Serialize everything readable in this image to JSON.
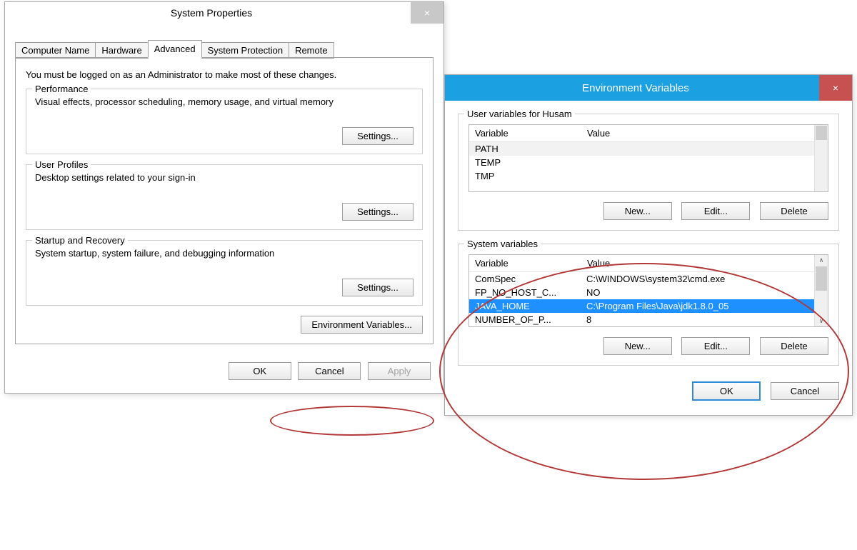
{
  "sysprops": {
    "title": "System Properties",
    "close": "×",
    "tabs": [
      "Computer Name",
      "Hardware",
      "Advanced",
      "System Protection",
      "Remote"
    ],
    "active_tab": 2,
    "admin_note": "You must be logged on as an Administrator to make most of these changes.",
    "performance": {
      "legend": "Performance",
      "desc": "Visual effects, processor scheduling, memory usage, and virtual memory",
      "btn": "Settings..."
    },
    "profiles": {
      "legend": "User Profiles",
      "desc": "Desktop settings related to your sign-in",
      "btn": "Settings..."
    },
    "startup": {
      "legend": "Startup and Recovery",
      "desc": "System startup, system failure, and debugging information",
      "btn": "Settings..."
    },
    "envvar_btn": "Environment Variables...",
    "ok": "OK",
    "cancel": "Cancel",
    "apply": "Apply"
  },
  "envvars": {
    "title": "Environment Variables",
    "close": "×",
    "user_legend": "User variables for Husam",
    "columns": {
      "var": "Variable",
      "val": "Value"
    },
    "user_rows": [
      {
        "var": "PATH",
        "val": ""
      },
      {
        "var": "TEMP",
        "val": ""
      },
      {
        "var": "TMP",
        "val": ""
      }
    ],
    "sys_legend": "System variables",
    "sys_rows": [
      {
        "var": "ComSpec",
        "val": "C:\\WINDOWS\\system32\\cmd.exe"
      },
      {
        "var": "FP_NO_HOST_C...",
        "val": "NO"
      },
      {
        "var": "JAVA_HOME",
        "val": "C:\\Program Files\\Java\\jdk1.8.0_05"
      },
      {
        "var": "NUMBER_OF_P...",
        "val": "8"
      }
    ],
    "sys_selected": 2,
    "new": "New...",
    "edit": "Edit...",
    "delete": "Delete",
    "ok": "OK",
    "cancel": "Cancel",
    "scroll_up": "∧",
    "scroll_down": "∨"
  }
}
